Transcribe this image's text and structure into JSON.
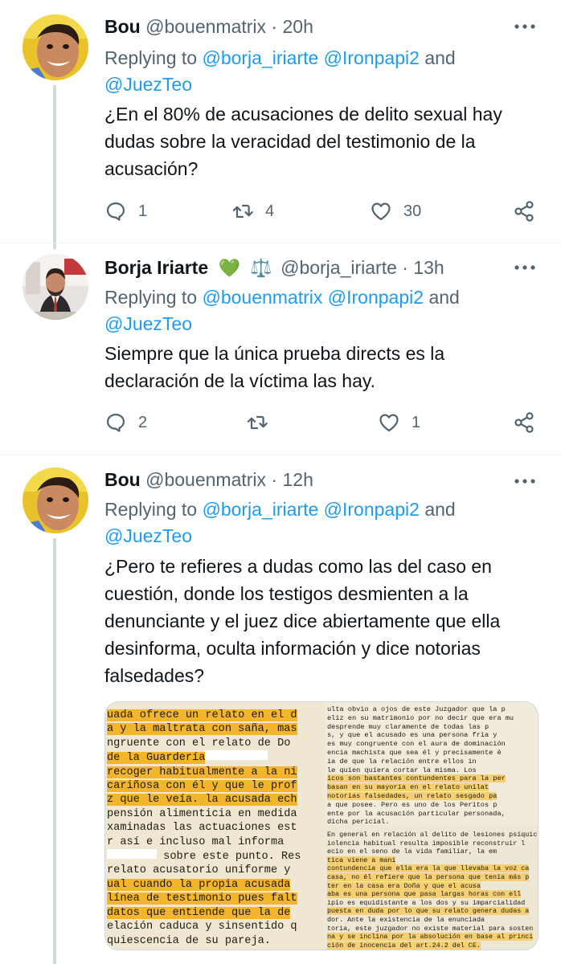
{
  "tweets": [
    {
      "name": "Bou",
      "handle": "@bouenmatrix",
      "time": "20h",
      "replying_prefix": "Replying to",
      "mentions": [
        "@borja_iriarte",
        "@Ironpapi2"
      ],
      "mentions_and": "and",
      "mentions_line2": "@JuezTeo",
      "text_lines": [
        "¿En el 80% de acusaciones de delito sexual hay",
        "dudas sobre la veracidad del testimonio de la",
        "acusación?"
      ],
      "replies": "1",
      "retweets": "4",
      "likes": "30"
    },
    {
      "name": "Borja Iriarte",
      "badge_heart": "💚",
      "badge_scales": "⚖️",
      "handle": "@borja_iriarte",
      "time": "13h",
      "replying_prefix": "Replying to",
      "mentions": [
        "@bouenmatrix",
        "@Ironpapi2"
      ],
      "mentions_and": "and",
      "mentions_line2": "@JuezTeo",
      "text_lines": [
        "Siempre que la única prueba directs es la",
        "declaración de la víctima las hay."
      ],
      "replies": "2",
      "retweets": "",
      "likes": "1"
    },
    {
      "name": "Bou",
      "handle": "@bouenmatrix",
      "time": "12h",
      "replying_prefix": "Replying to",
      "mentions": [
        "@borja_iriarte",
        "@Ironpapi2"
      ],
      "mentions_and": "and",
      "mentions_line2": "@JuezTeo",
      "text_lines": [
        "¿Pero te refieres a dudas como las del caso en",
        "cuestión, donde los testigos desmienten a la",
        "denunciante y el juez dice abiertamente que ella",
        "desinforma, oculta información y dice notorias",
        "falsedades?"
      ]
    }
  ],
  "doc_left": [
    "uada ofrece un relato en el d",
    "a y la maltrata con saña, mas",
    "ngruente con el relato de Do",
    " de la Guardería",
    " recoger habitualmente a la ni",
    " cariñosa con él y que le prof",
    "z que le veía. la acusada ech",
    " pensión alimenticia en medida",
    "xaminadas las actuaciones est",
    "r así e incluso mal informa",
    "        sobre este punto. Res",
    "relato acusatorio uniforme y",
    "ual cuando la propia acusada",
    "línea de testimonio pues falt",
    " datos que entiende que la de",
    "elación caduca y sinsentido q",
    "quiescencia de su pareja."
  ],
  "doc_right_top": [
    "ulta obvio a ojos de este Juzgador que la p",
    "eliz en su matrimonio por no decir que era mu",
    "    desprende muy claramente de todas las p",
    "s, y que el acusado es una persona fría y",
    "es muy congruente con el aura de dominación",
    "encia machista que sea él y precisamente é",
    "ia de que la relación entre ellos in",
    "le quien quiera cortar la misma. Los",
    "icos son bastantes contundentes para la per",
    " basan en su mayoría en el relato unilat",
    " notorias falsedades, un relato sesgado pa",
    "a que posee. Pero es uno de los Peritos p",
    "ente por la acusación particular personada,",
    "dicha pericial."
  ],
  "doc_right_bottom": [
    "En general en relación al delito de lesiones psíquic",
    "iolencia habitual resulta imposible reconstruir l",
    "ecio en el seno de la vida familiar, la em",
    "tica              viene a mani",
    "contundencia que ella era la que llevaba la voz ca",
    " casa, no él refiere que la persona que tenía más p",
    "ter en la casa era Doña       y que el acusa",
    "aba es una persona que pasa largas horas con ell",
    "ipio es equidistante a los dos y su imparcialidad",
    "puesta en duda por lo que su relato genera dudas a",
    "dor. Ante la existencia de la enunciada",
    "toria, este juzgador no existe material para sosten",
    "na y se inclina por la absolución en base al princi",
    "ción de inocencia del art.24.2 del CE."
  ]
}
